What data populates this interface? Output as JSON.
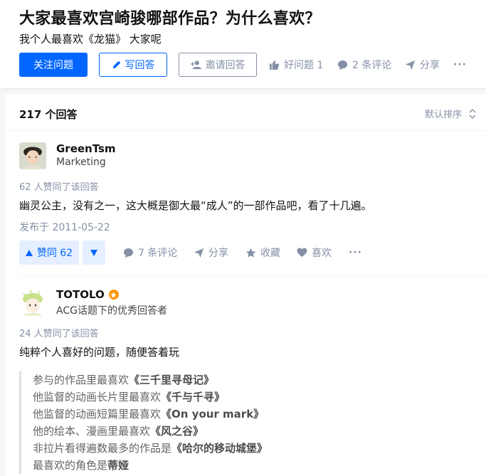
{
  "question": {
    "title": "大家最喜欢宫崎骏哪部作品？为什么喜欢？",
    "detail": "我个人最喜欢《龙猫》 大家呢"
  },
  "header_actions": {
    "follow": "关注问题",
    "write": "写回答",
    "invite": "邀请回答",
    "good_question": "好问题 1",
    "comments": "2 条评论",
    "share": "分享",
    "more": "···"
  },
  "answer_list": {
    "count": "217 个回答",
    "sort": "默认排序"
  },
  "answers": [
    {
      "author": "GreenTsm",
      "headline": "Marketing",
      "votes_line": "62 人赞同了该回答",
      "content": "幽灵公主，没有之一，这大概是御大最“成人”的一部作品吧，看了十几遍。",
      "date": "发布于 2011-05-22",
      "actions": {
        "upvote": "赞同 62",
        "comments": "7 条评论",
        "share": "分享",
        "collect": "收藏",
        "like": "喜欢",
        "more": "···"
      }
    },
    {
      "author": "TOTOLO",
      "headline": "ACG话题下的优秀回答者",
      "votes_line": "24 人赞同了该回答",
      "content": "纯粹个人喜好的问题，随便答着玩",
      "quote": [
        {
          "prefix": "参与的作品里最喜欢",
          "bold": "《三千里寻母记》"
        },
        {
          "prefix": "他监督的动画长片里最喜欢",
          "bold": "《千与千寻》"
        },
        {
          "prefix": "他监督的动画短篇里最喜欢",
          "bold": "《On your mark》"
        },
        {
          "prefix": "他的绘本、漫画里最喜欢",
          "bold": "《风之谷》"
        },
        {
          "prefix": "非拉片看得遍数最多的作品是",
          "bold": "《哈尔的移动城堡》"
        },
        {
          "prefix": "最喜欢的角色是",
          "bold": "蒂娅"
        }
      ]
    }
  ],
  "colors": {
    "brand": "#0066ff",
    "muted": "#8590a6",
    "badge": "#ff9607"
  }
}
